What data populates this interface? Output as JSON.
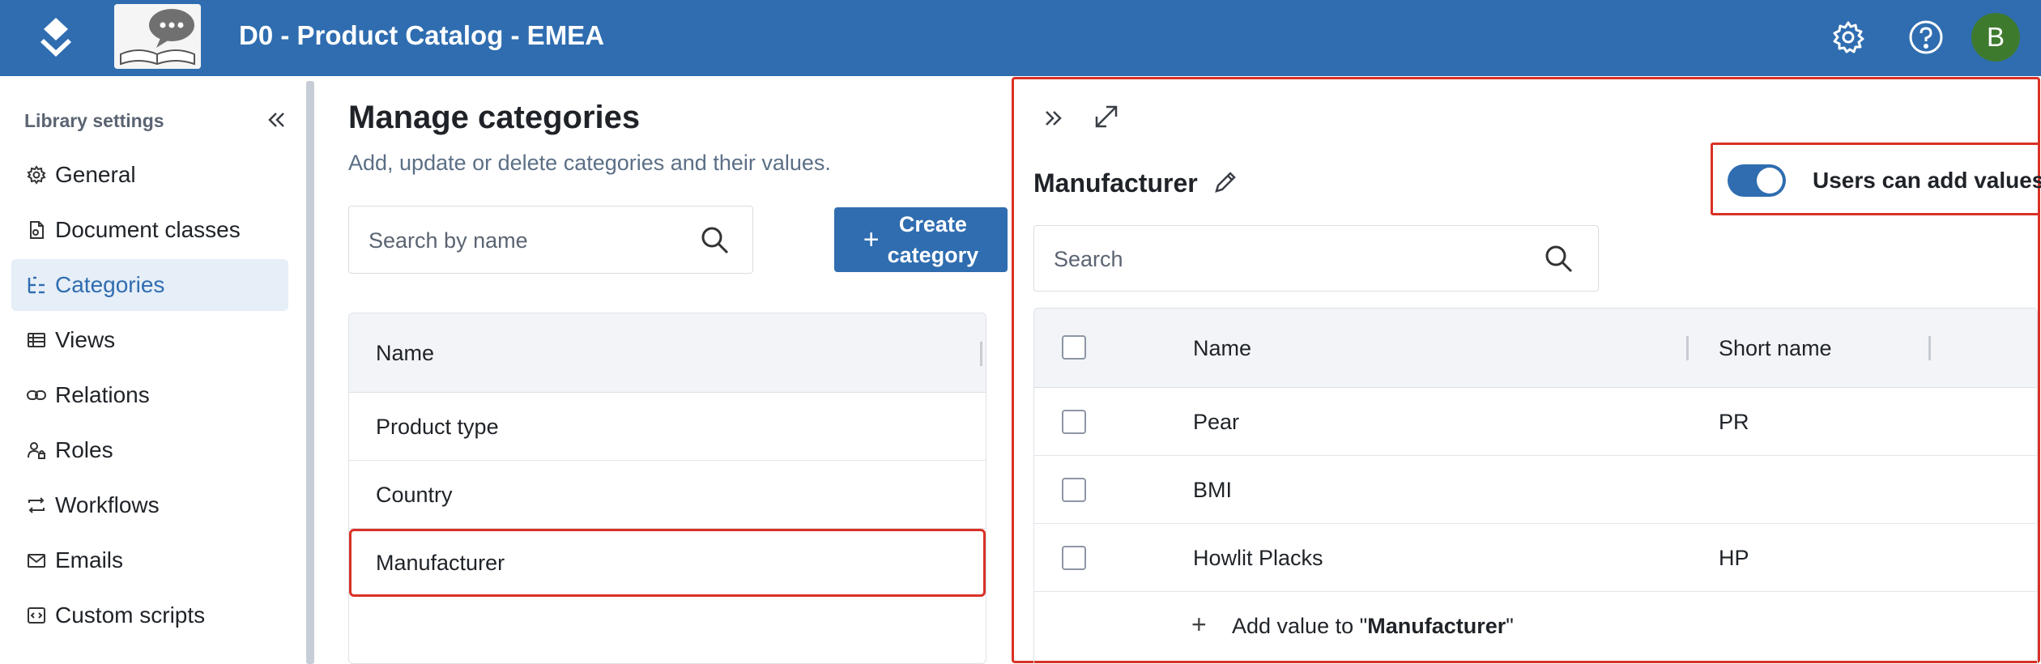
{
  "header": {
    "title": "D0 - Product Catalog - EMEA",
    "avatar_initial": "B",
    "brand_color": "#2f6db0"
  },
  "sidebar": {
    "title": "Library settings",
    "items": [
      {
        "label": "General",
        "icon": "gear-icon"
      },
      {
        "label": "Document classes",
        "icon": "document-class-icon"
      },
      {
        "label": "Categories",
        "icon": "category-tree-icon",
        "active": true
      },
      {
        "label": "Views",
        "icon": "table-view-icon"
      },
      {
        "label": "Relations",
        "icon": "link-icon"
      },
      {
        "label": "Roles",
        "icon": "user-role-icon"
      },
      {
        "label": "Workflows",
        "icon": "workflow-icon"
      },
      {
        "label": "Emails",
        "icon": "mail-icon"
      },
      {
        "label": "Custom scripts",
        "icon": "code-icon"
      }
    ]
  },
  "main": {
    "title": "Manage categories",
    "subtitle": "Add, update or delete categories and their values.",
    "search_placeholder": "Search by name",
    "create_button": {
      "line1": "Create",
      "line2": "category"
    },
    "table": {
      "column_name": "Name",
      "rows": [
        "Product type",
        "Country",
        "Manufacturer"
      ],
      "selected": "Manufacturer"
    }
  },
  "panel": {
    "title": "Manufacturer",
    "toggle_label": "Users can add values",
    "toggle_on": true,
    "search_placeholder": "Search",
    "columns": {
      "name": "Name",
      "short_name": "Short name"
    },
    "rows": [
      {
        "name": "Pear",
        "short_name": "PR"
      },
      {
        "name": "BMI",
        "short_name": ""
      },
      {
        "name": "Howlit Placks",
        "short_name": "HP"
      }
    ],
    "add_value": {
      "prefix": "Add value to ",
      "quote_open": "\"",
      "target": "Manufacturer",
      "quote_close": "\""
    }
  },
  "highlight_color": "#d93025"
}
